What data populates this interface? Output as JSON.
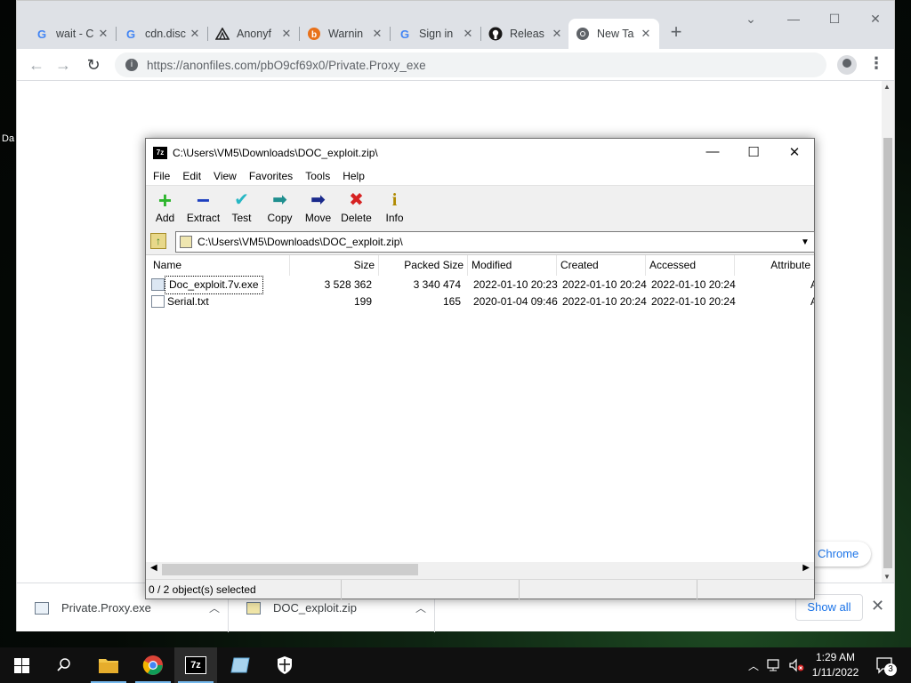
{
  "desktop": {
    "label": "Da"
  },
  "browser": {
    "tabs": [
      {
        "title": "wait - C",
        "icon": "google-icon"
      },
      {
        "title": "cdn.disc",
        "icon": "google-icon"
      },
      {
        "title": "Anonyf",
        "icon": "anonfiles-icon"
      },
      {
        "title": "Warnin",
        "icon": "warning-site-icon"
      },
      {
        "title": "Sign in",
        "icon": "google-icon"
      },
      {
        "title": "Releas",
        "icon": "github-icon"
      },
      {
        "title": "New Ta",
        "icon": "chrome-icon"
      }
    ],
    "url": "https://anonfiles.com/pbO9cf69x0/Private.Proxy_exe",
    "pill_text": "Chrome",
    "downloads": [
      {
        "name": "Private.Proxy.exe"
      },
      {
        "name": "DOC_exploit.zip"
      }
    ],
    "show_all": "Show all"
  },
  "sevenzip": {
    "title": "C:\\Users\\VM5\\Downloads\\DOC_exploit.zip\\",
    "menu": [
      "File",
      "Edit",
      "View",
      "Favorites",
      "Tools",
      "Help"
    ],
    "toolbar": [
      "Add",
      "Extract",
      "Test",
      "Copy",
      "Move",
      "Delete",
      "Info"
    ],
    "path": "C:\\Users\\VM5\\Downloads\\DOC_exploit.zip\\",
    "columns": [
      "Name",
      "Size",
      "Packed Size",
      "Modified",
      "Created",
      "Accessed",
      "Attribute"
    ],
    "rows": [
      {
        "name": "Doc_exploit.7v.exe",
        "size": "3 528 362",
        "packed": "3 340 474",
        "modified": "2022-01-10 20:23",
        "created": "2022-01-10 20:24",
        "accessed": "2022-01-10 20:24",
        "attr": "A"
      },
      {
        "name": "Serial.txt",
        "size": "199",
        "packed": "165",
        "modified": "2020-01-04 09:46",
        "created": "2022-01-10 20:24",
        "accessed": "2022-01-10 20:24",
        "attr": "A"
      }
    ],
    "status": "0 / 2 object(s) selected"
  },
  "taskbar": {
    "time": "1:29 AM",
    "date": "1/11/2022",
    "notifications": "3"
  },
  "colors": {
    "accent": "#1a73e8",
    "taskbar": "#101010",
    "running_indicator": "#76b9ed"
  }
}
